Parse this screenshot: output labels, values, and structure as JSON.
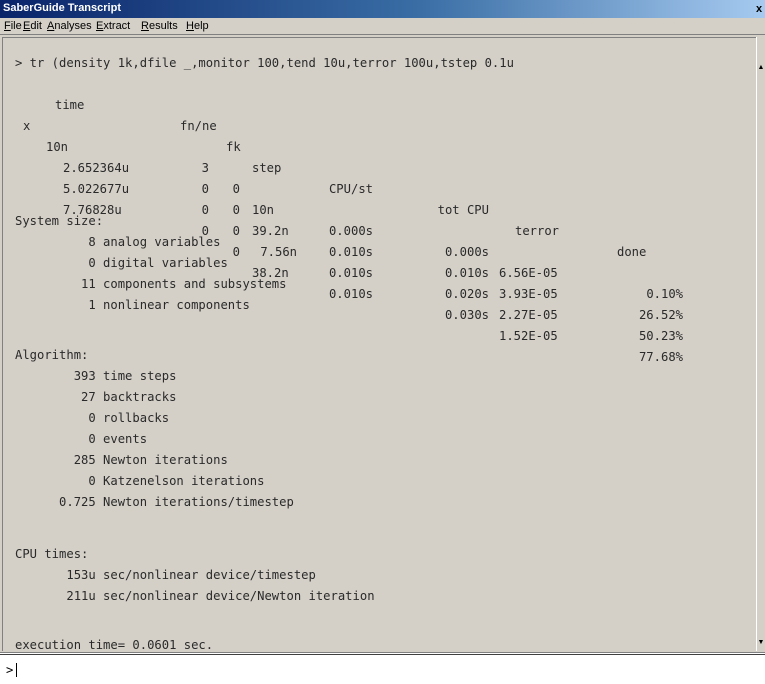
{
  "window": {
    "title": "SaberGuide Transcript",
    "close_glyph": "x"
  },
  "menu": [
    {
      "first": "F",
      "rest": "ile"
    },
    {
      "first": "E",
      "rest": "dit"
    },
    {
      "first": "A",
      "rest": "nalyses"
    },
    {
      "first": "E",
      "rest": "xtract"
    },
    {
      "first": "R",
      "rest": "esults"
    },
    {
      "first": "H",
      "rest": "elp"
    }
  ],
  "transcript": {
    "command": "> tr (density 1k,dfile _,monitor 100,tend 10u,terror 100u,tstep 0.1u",
    "table": {
      "headers": [
        "time",
        "fn/ne",
        "fk",
        "step",
        "CPU/st",
        "tot CPU",
        "terror",
        "done"
      ],
      "rows": [
        {
          "mark": "x",
          "time": "10n",
          "fnne": "3",
          "fk": "0",
          "step": "10n",
          "cpust": "0.000s",
          "totcpu": "0.000s",
          "terror": "6.56E-05",
          "done": "0.10%"
        },
        {
          "mark": "",
          "time": "2.652364u",
          "fnne": "0",
          "fk": "0",
          "step": "39.2n",
          "cpust": "0.010s",
          "totcpu": "0.010s",
          "terror": "3.93E-05",
          "done": "26.52%"
        },
        {
          "mark": "",
          "time": "5.022677u",
          "fnne": "0",
          "fk": "0",
          "step": "7.56n",
          "cpust": "0.010s",
          "totcpu": "0.020s",
          "terror": "2.27E-05",
          "done": "50.23%"
        },
        {
          "mark": "",
          "time": "7.76828u",
          "fnne": "0",
          "fk": "0",
          "step": "38.2n",
          "cpust": "0.010s",
          "totcpu": "0.030s",
          "terror": "1.52E-05",
          "done": "77.68%"
        }
      ]
    },
    "system_size": {
      "heading": "System size:",
      "lines": [
        "          8 analog variables",
        "          0 digital variables",
        "         11 components and subsystems",
        "          1 nonlinear components"
      ]
    },
    "algorithm": {
      "heading": "Algorithm:",
      "lines": [
        "        393 time steps",
        "         27 backtracks",
        "          0 rollbacks",
        "          0 events",
        "        285 Newton iterations",
        "          0 Katzenelson iterations",
        "      0.725 Newton iterations/timestep"
      ]
    },
    "cpu_times": {
      "heading": "CPU times:",
      "lines": [
        "       153u sec/nonlinear device/timestep",
        "       211u sec/nonlinear device/Newton iteration"
      ]
    },
    "execution": "execution time= 0.0601 sec."
  },
  "command_line": {
    "prompt": ">",
    "value": ""
  }
}
